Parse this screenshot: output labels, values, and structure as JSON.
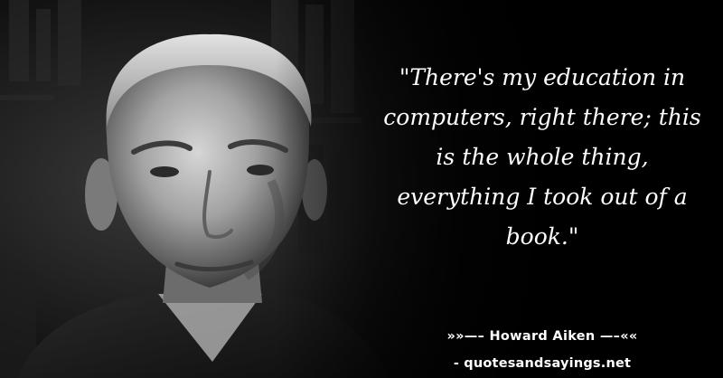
{
  "quote": {
    "text": "\"There's my education in computers, right there; this is the whole thing, everything I took out of a book.\""
  },
  "attribution": {
    "author_line": "»»—– Howard Aiken —–««"
  },
  "source": {
    "site_line": "- quotesandsayings.net"
  },
  "colors": {
    "background": "#000000",
    "text": "#ffffff"
  }
}
